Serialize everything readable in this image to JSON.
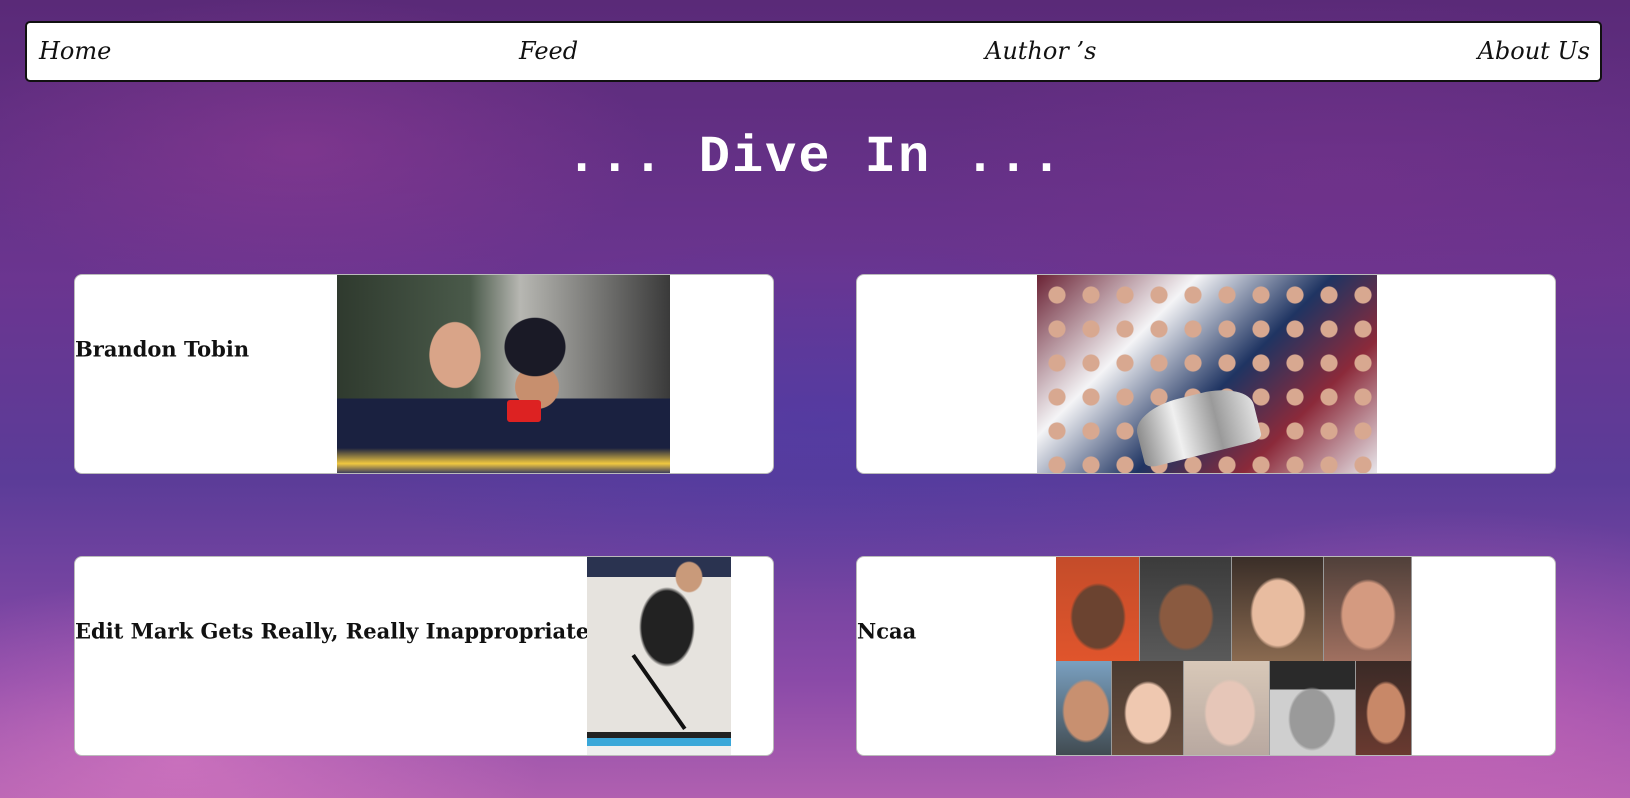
{
  "nav": {
    "home": "Home",
    "feed": "Feed",
    "authors": "Author ’s",
    "about": "About Us"
  },
  "headline": "... Dive In ...",
  "cards": [
    {
      "title": "Brandon Tobin",
      "image": "hockey-fight-photo"
    },
    {
      "title": "",
      "image": "stanley-cup-celebration-photo"
    },
    {
      "title": "Edit Mark Gets Really, Really Inappropriate",
      "image": "mark-hardy-hockey-card"
    },
    {
      "title": "Ncaa",
      "image": "face-collage-photo"
    }
  ],
  "colors": {
    "background_top": "#5a2a78",
    "background_bottom": "#b060b0",
    "card": "#ffffff",
    "headline": "#ffffff"
  }
}
